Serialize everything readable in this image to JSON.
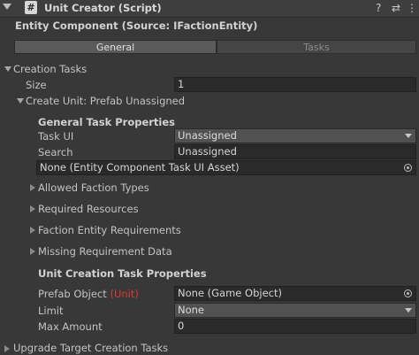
{
  "header": {
    "title": "Unit Creator (Script)",
    "script_glyph": "#",
    "help_glyph": "?",
    "preset_glyph": "⇄",
    "menu_glyph": "⋮"
  },
  "component_title": "Entity Component (Source: IFactionEntity)",
  "tabs": [
    {
      "label": "General",
      "active": true
    },
    {
      "label": "Tasks",
      "active": false
    }
  ],
  "creation_tasks": {
    "label": "Creation Tasks",
    "size_label": "Size",
    "size_value": "1",
    "element_label": "Create Unit: Prefab Unassigned",
    "general_section": "General Task Properties",
    "task_ui_label": "Task UI",
    "task_ui_value": "Unassigned",
    "search_label": "Search",
    "search_value": "Unassigned",
    "asset_value": "None (Entity Component Task UI Asset)",
    "foldouts": [
      "Allowed Faction Types",
      "Required Resources",
      "Faction Entity Requirements",
      "Missing Requirement Data"
    ],
    "unit_section": "Unit Creation Task Properties",
    "prefab_label": "Prefab Object",
    "prefab_tag": "(Unit)",
    "prefab_value": "None (Game Object)",
    "limit_label": "Limit",
    "limit_value": "None",
    "max_amount_label": "Max Amount",
    "max_amount_value": "0"
  },
  "upgrade_label": "Upgrade Target Creation Tasks",
  "colors": {
    "background": "#383838",
    "field": "#2a2a2a",
    "accent_red": "#d83a3a"
  },
  "icons": [
    "script-icon",
    "help-icon",
    "preset-icon",
    "menu-icon",
    "object-picker-icon",
    "dropdown-arrow-icon",
    "foldout-arrow-icon"
  ]
}
